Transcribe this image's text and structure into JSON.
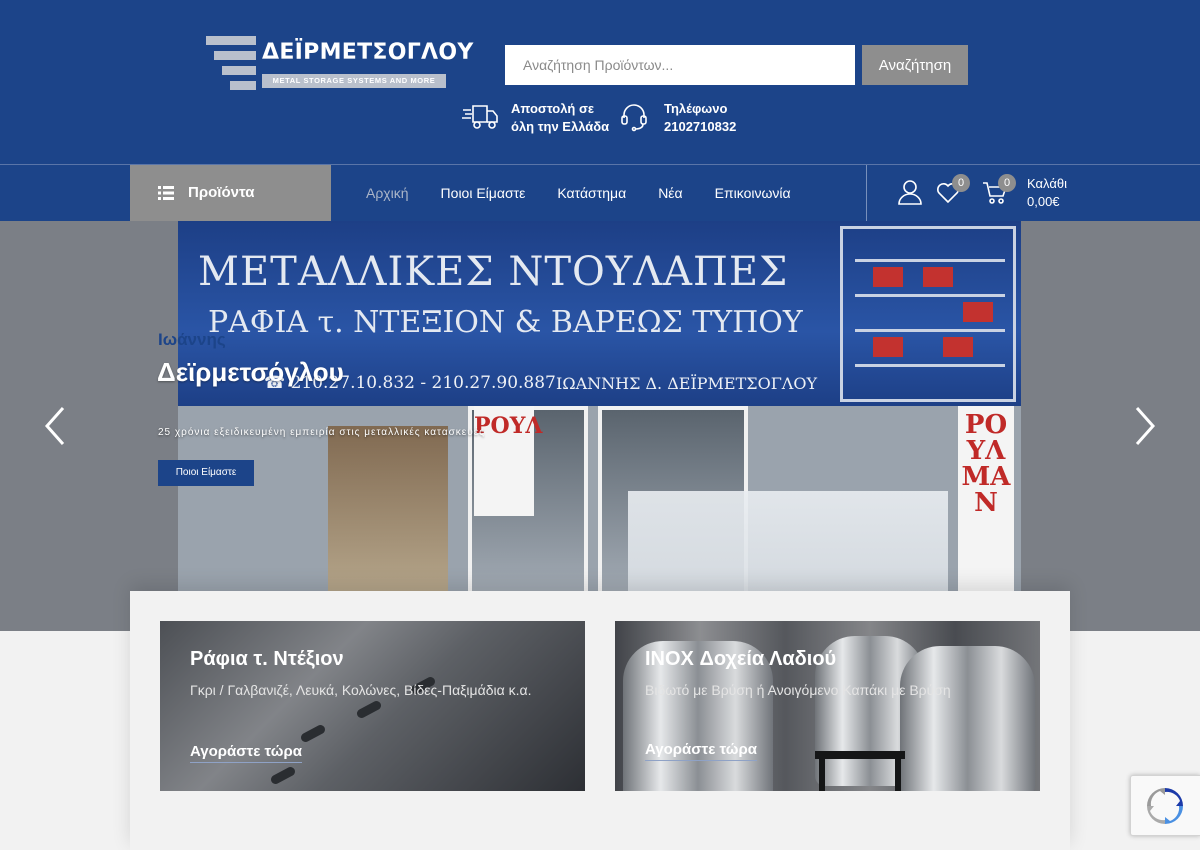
{
  "brand": {
    "name": "ΔΕΪΡΜΕΤΣΟΓΛΟΥ",
    "tagline": "METAL STORAGE SYSTEMS AND MORE",
    "primary_color": "#1c4489",
    "accent_gray": "#8e8e8e"
  },
  "search": {
    "placeholder": "Αναζήτηση Προϊόντων...",
    "button_label": "Αναζήτηση"
  },
  "header_info": {
    "shipping_line1": "Αποστολή σε",
    "shipping_line2": "όλη την Ελλάδα",
    "phone_label": "Τηλέφωνο",
    "phone_number": "2102710832"
  },
  "nav": {
    "products_label": "Προϊόντα",
    "links": [
      {
        "label": "Αρχική",
        "active": true
      },
      {
        "label": "Ποιοι Είμαστε",
        "active": false
      },
      {
        "label": "Κατάστημα",
        "active": false
      },
      {
        "label": "Νέα",
        "active": false
      },
      {
        "label": "Επικοινωνία",
        "active": false
      }
    ],
    "wishlist_count": "0",
    "cart_count": "0",
    "cart_label": "Καλάθι",
    "cart_total": "0,00€"
  },
  "hero": {
    "kicker": "Ιωάννης",
    "title": "Δεϊρμετσόγλου",
    "description": "25 χρόνια εξειδικευμένη εμπειρία στις μεταλλικές κατασκευές",
    "button_label": "Ποιοι Είμαστε",
    "photo_sign_main": "ΜΕΤΑΛΛΙΚΕΣ ΝΤΟΥΛΑΠΕΣ",
    "photo_sign_sub": "ΡΑΦΙΑ τ. ΝΤΕΞΙΟΝ & ΒΑΡΕΩΣ ΤΥΠΟΥ",
    "photo_sign_phones": "☎ 210.27.10.832 - 210.27.90.887",
    "photo_sign_owner": "ΙΩΑΝΝΗΣ Δ. ΔΕΪΡΜΕΤΣΟΓΛΟΥ",
    "photo_side_sign": "ΡΟΥΛΜΑΝ",
    "photo_door_sign": "ΡΟΥΛ"
  },
  "banners": [
    {
      "title": "Ράφια τ. Ντέξιον",
      "subtitle": "Γκρι / Γαλβανιζέ, Λευκά, Κολώνες, Βίδες-Παξιμάδια κ.α.",
      "link": "Αγοράστε τώρα"
    },
    {
      "title": "INOX Δοχεία Λαδιού",
      "subtitle": "Βιδωτό με Βρύση ή Ανοιγόμενο Καπάκι με Βρύση",
      "link": "Αγοράστε τώρα"
    }
  ],
  "icons": {
    "shipping": "truck-icon",
    "phone": "headset-icon",
    "menu": "list-icon",
    "account": "user-icon",
    "wishlist": "heart-icon",
    "cart": "cart-icon",
    "prev": "chevron-left-icon",
    "next": "chevron-right-icon",
    "captcha": "recaptcha-icon"
  }
}
